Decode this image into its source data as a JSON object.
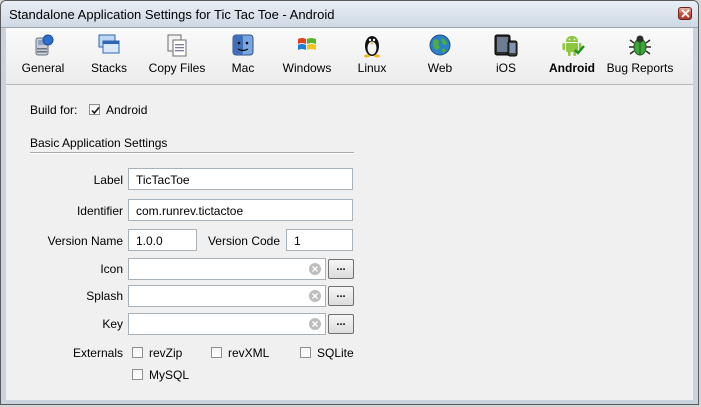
{
  "window": {
    "title": "Standalone Application Settings for Tic Tac Toe - Android"
  },
  "toolbar": {
    "items": [
      {
        "label": "General",
        "icon": "general-icon"
      },
      {
        "label": "Stacks",
        "icon": "stacks-icon"
      },
      {
        "label": "Copy Files",
        "icon": "copy-files-icon"
      },
      {
        "label": "Mac",
        "icon": "mac-icon"
      },
      {
        "label": "Windows",
        "icon": "windows-icon"
      },
      {
        "label": "Linux",
        "icon": "linux-icon"
      },
      {
        "label": "Web",
        "icon": "web-icon"
      },
      {
        "label": "iOS",
        "icon": "ios-icon"
      },
      {
        "label": "Android",
        "icon": "android-icon",
        "active": true
      },
      {
        "label": "Bug Reports",
        "icon": "bug-icon"
      }
    ]
  },
  "build_for": {
    "label": "Build for:",
    "platform": "Android",
    "checked": true
  },
  "section": {
    "title": "Basic Application Settings"
  },
  "fields": {
    "label": {
      "label": "Label",
      "value": "TicTacToe"
    },
    "identifier": {
      "label": "Identifier",
      "value": "com.runrev.tictactoe"
    },
    "version_name": {
      "label": "Version Name",
      "value": "1.0.0"
    },
    "version_code": {
      "label": "Version Code",
      "value": "1"
    },
    "icon": {
      "label": "Icon",
      "value": ""
    },
    "splash": {
      "label": "Splash",
      "value": ""
    },
    "key": {
      "label": "Key",
      "value": ""
    }
  },
  "browse_label": "...",
  "externals": {
    "label": "Externals",
    "options": [
      {
        "label": "revZip",
        "checked": false
      },
      {
        "label": "revXML",
        "checked": false
      },
      {
        "label": "SQLite",
        "checked": false
      },
      {
        "label": "MySQL",
        "checked": false
      }
    ]
  }
}
